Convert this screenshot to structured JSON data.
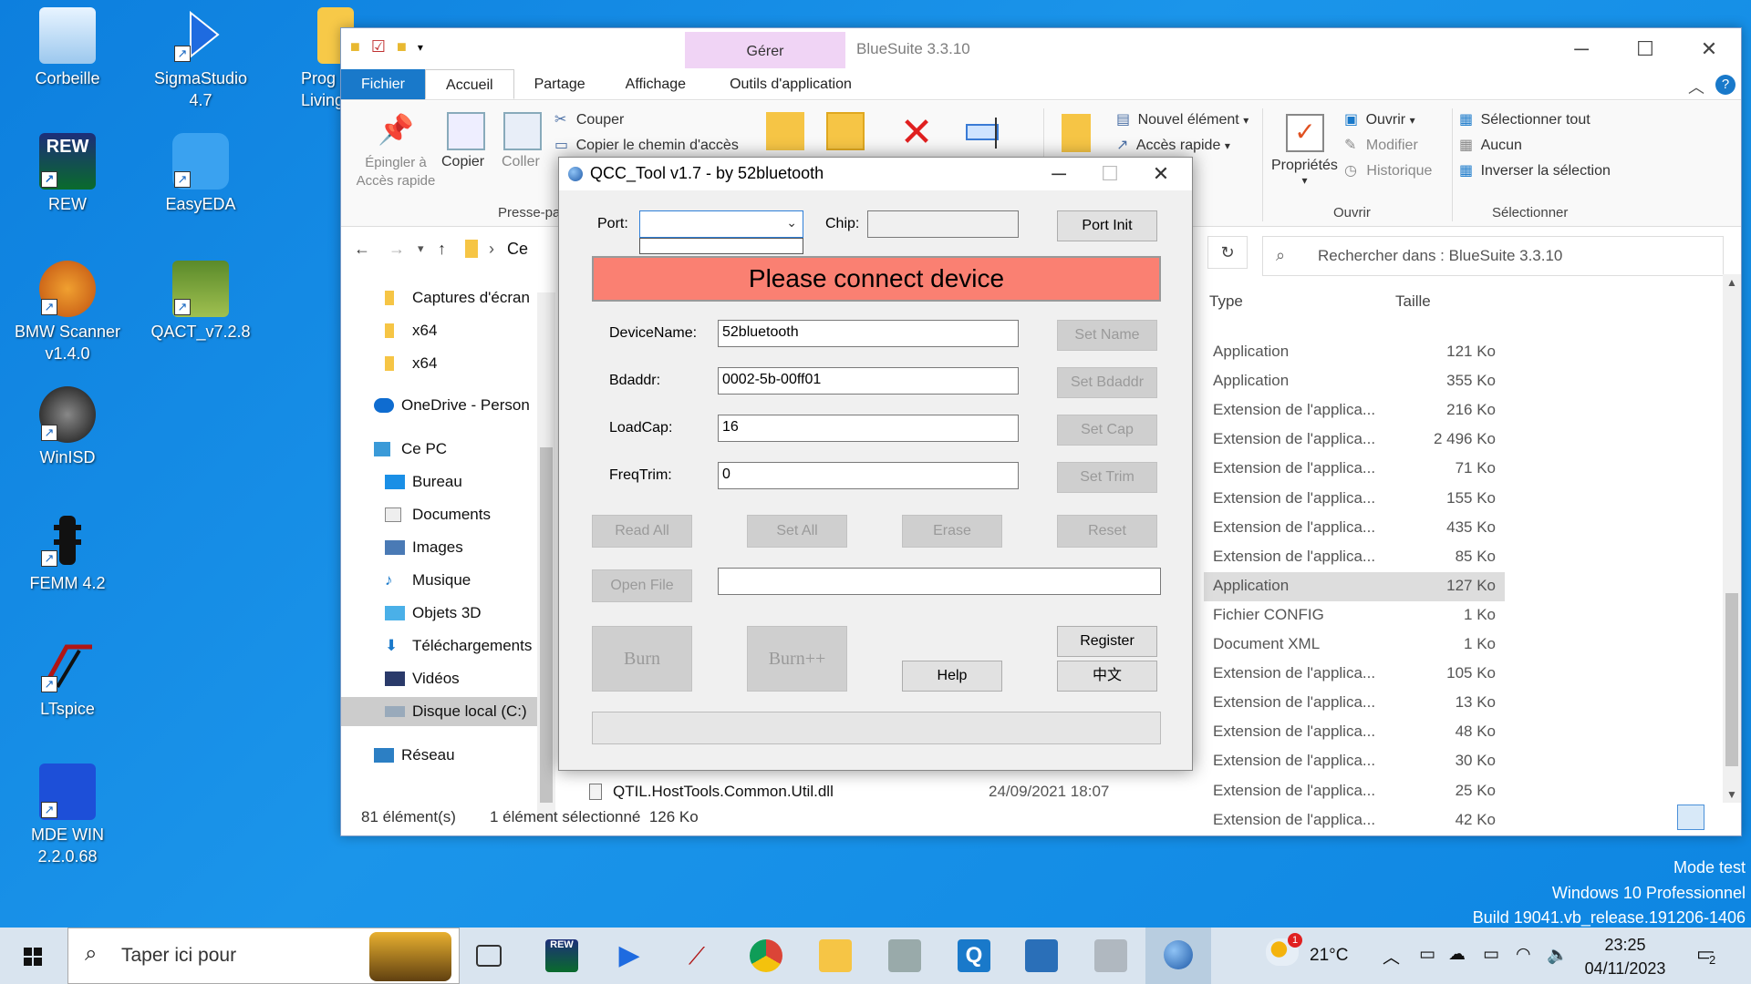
{
  "desktop": {
    "icons": [
      {
        "label": "Corbeille",
        "icon": "recycle-bin-icon"
      },
      {
        "label": "SigmaStudio 4.7",
        "icon": "sigmastudio-icon"
      },
      {
        "label": "Prog Livings",
        "icon": "folder-icon"
      },
      {
        "label": "REW",
        "icon": "rew-icon"
      },
      {
        "label": "EasyEDA",
        "icon": "easyeda-icon"
      },
      {
        "label": "BMW Scanner v1.4.0",
        "icon": "bmw-scanner-icon"
      },
      {
        "label": "QACT_v7.2.8",
        "icon": "qact-icon"
      },
      {
        "label": "WinISD",
        "icon": "winisd-icon"
      },
      {
        "label": "FEMM 4.2",
        "icon": "femm-icon"
      },
      {
        "label": "LTspice",
        "icon": "ltspice-icon"
      },
      {
        "label": "MDE WIN 2.2.0.68",
        "icon": "mde-win-icon"
      }
    ],
    "watermark": [
      "Mode test",
      "Windows 10 Professionnel",
      "Build 19041.vb_release.191206-1406"
    ]
  },
  "explorer": {
    "title": "BlueSuite 3.3.10",
    "contextual_group": "Gérer",
    "tabs": [
      "Fichier",
      "Accueil",
      "Partage",
      "Affichage",
      "Outils d'application"
    ],
    "ribbon": {
      "pin": "Épingler à Accès rapide",
      "copy": "Copier",
      "paste": "Coller",
      "cut": "Couper",
      "copy_path": "Copier le chemin d'accès",
      "clipboard_group": "Presse-pa",
      "new_item": "Nouvel élément",
      "quick_access": "Accès rapide",
      "properties": "Propriétés",
      "open": "Ouvrir",
      "edit": "Modifier",
      "history": "Historique",
      "open_group": "Ouvrir",
      "select_all": "Sélectionner tout",
      "select_none": "Aucun",
      "invert_selection": "Inverser la sélection",
      "select_group": "Sélectionner"
    },
    "address_crumb": "Ce",
    "search_placeholder": "Rechercher dans : BlueSuite 3.3.10",
    "nav": [
      {
        "label": "Captures d'écran",
        "icon": "folder-icon"
      },
      {
        "label": "x64",
        "icon": "folder-icon"
      },
      {
        "label": "x64",
        "icon": "folder-icon"
      },
      {
        "label": "OneDrive - Person",
        "icon": "onedrive-icon"
      },
      {
        "label": "Ce PC",
        "icon": "pc-icon"
      },
      {
        "label": "Bureau",
        "icon": "desktop-folder-icon"
      },
      {
        "label": "Documents",
        "icon": "documents-icon"
      },
      {
        "label": "Images",
        "icon": "images-icon"
      },
      {
        "label": "Musique",
        "icon": "music-icon"
      },
      {
        "label": "Objets 3D",
        "icon": "objects-3d-icon"
      },
      {
        "label": "Téléchargements",
        "icon": "downloads-icon"
      },
      {
        "label": "Vidéos",
        "icon": "videos-icon"
      },
      {
        "label": "Disque local (C:)",
        "icon": "drive-icon"
      },
      {
        "label": "Réseau",
        "icon": "network-icon"
      }
    ],
    "columns": {
      "type": "Type",
      "size": "Taille"
    },
    "rows": [
      {
        "type": "Application",
        "size": "121 Ko"
      },
      {
        "type": "Application",
        "size": "355 Ko"
      },
      {
        "type": "Extension de l'applica...",
        "size": "216 Ko"
      },
      {
        "type": "Extension de l'applica...",
        "size": "2 496 Ko"
      },
      {
        "type": "Extension de l'applica...",
        "size": "71 Ko"
      },
      {
        "type": "Extension de l'applica...",
        "size": "155 Ko"
      },
      {
        "type": "Extension de l'applica...",
        "size": "435 Ko"
      },
      {
        "type": "Extension de l'applica...",
        "size": "85 Ko"
      },
      {
        "type": "Application",
        "size": "127 Ko"
      },
      {
        "type": "Fichier CONFIG",
        "size": "1 Ko"
      },
      {
        "type": "Document XML",
        "size": "1 Ko"
      },
      {
        "type": "Extension de l'applica...",
        "size": "105 Ko"
      },
      {
        "type": "Extension de l'applica...",
        "size": "13 Ko"
      },
      {
        "type": "Extension de l'applica...",
        "size": "48 Ko"
      },
      {
        "type": "Extension de l'applica...",
        "size": "30 Ko"
      },
      {
        "type": "Extension de l'applica...",
        "size": "25 Ko"
      },
      {
        "type": "Extension de l'applica...",
        "size": "42 Ko"
      }
    ],
    "last_file": {
      "name": "QTIL.HostTools.Common.Util.dll",
      "date": "24/09/2021 18:07"
    },
    "status": {
      "count": "81 élément(s)",
      "selection": "1 élément sélectionné  126 Ko"
    }
  },
  "qcc": {
    "title": "QCC_Tool v1.7 - by 52bluetooth",
    "port_label": "Port:",
    "chip_label": "Chip:",
    "port_init": "Port Init",
    "banner": "Please connect device",
    "banner_color": "#fa8072",
    "device_name_label": "DeviceName:",
    "device_name": "52bluetooth",
    "bdaddr_label": "Bdaddr:",
    "bdaddr": "0002-5b-00ff01",
    "loadcap_label": "LoadCap:",
    "loadcap": "16",
    "freqtrim_label": "FreqTrim:",
    "freqtrim": "0",
    "set_name": "Set Name",
    "set_bdaddr": "Set Bdaddr",
    "set_cap": "Set Cap",
    "set_trim": "Set Trim",
    "read_all": "Read All",
    "set_all": "Set All",
    "erase": "Erase",
    "reset": "Reset",
    "open_file": "Open File",
    "burn": "Burn",
    "burn_pp": "Burn++",
    "help": "Help",
    "register": "Register",
    "chinese": "中文"
  },
  "taskbar": {
    "search_placeholder": "Taper ici pour",
    "weather": "21°C",
    "weather_badge": "1",
    "time": "23:25",
    "date": "04/11/2023",
    "notif_count": "2"
  }
}
